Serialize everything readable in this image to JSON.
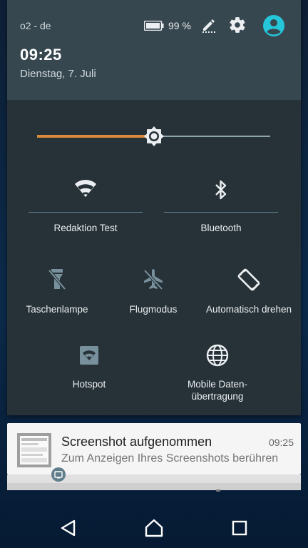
{
  "status": {
    "carrier": "o2 - de",
    "battery": "99 %"
  },
  "header": {
    "time": "09:25",
    "date": "Dienstag, 7. Juli"
  },
  "brightness": {
    "level": 0.5
  },
  "tiles": {
    "wifi": "Redaktion Test",
    "bluetooth": "Bluetooth",
    "flashlight": "Taschenlampe",
    "airplane": "Flugmodus",
    "rotate": "Automatisch drehen",
    "hotspot": "Hotspot",
    "mobile_data_line1": "Mobile Daten-",
    "mobile_data_line2": "übertragung"
  },
  "notification": {
    "title": "Screenshot aufgenommen",
    "time": "09:25",
    "text": "Zum Anzeigen Ihres Screenshots berühren"
  },
  "icons": {
    "battery": "battery-icon",
    "edit": "edit-icon",
    "settings": "gear-icon",
    "avatar": "account-icon",
    "wifi": "wifi-icon",
    "bluetooth": "bluetooth-icon",
    "flashlight": "flashlight-icon",
    "airplane": "airplane-icon",
    "rotate": "rotate-icon",
    "hotspot": "hotspot-icon",
    "globe": "globe-icon",
    "back": "back-icon",
    "home": "home-icon",
    "recents": "recents-icon"
  },
  "colors": {
    "accent": "#d98a3a",
    "avatar": "#26c6da",
    "shade": "#263238",
    "header": "#37474f"
  }
}
